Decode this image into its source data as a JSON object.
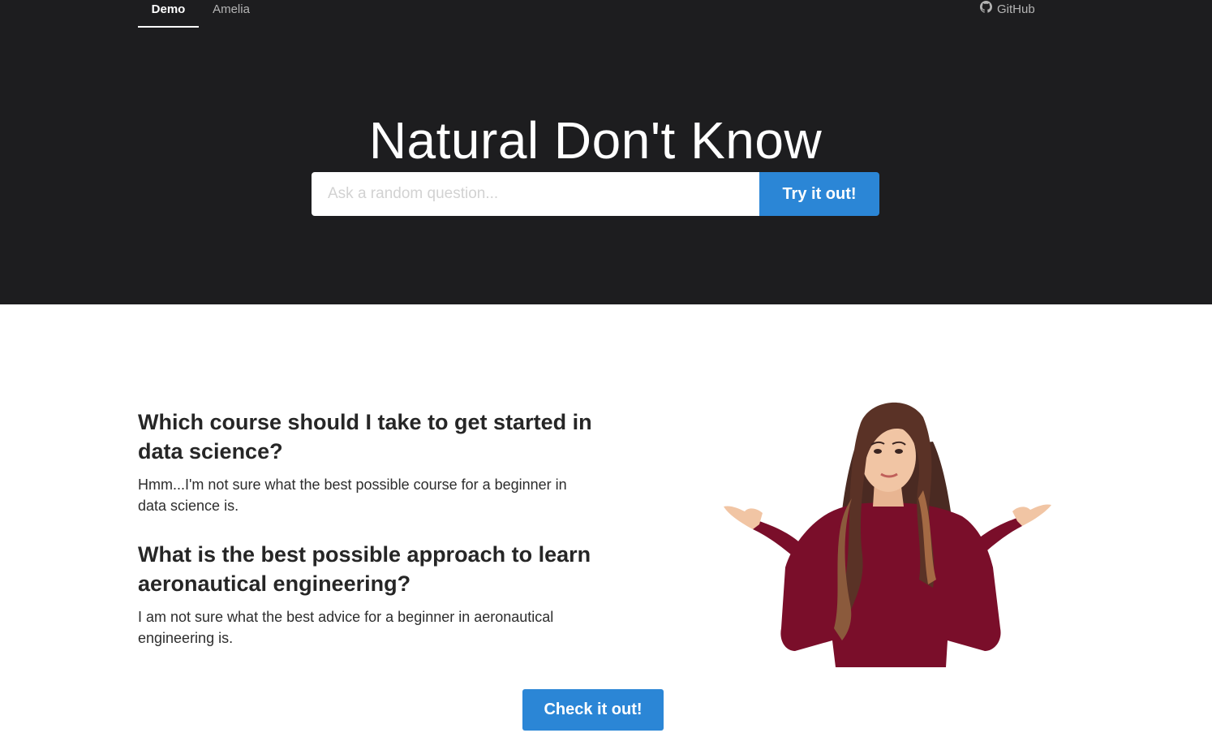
{
  "nav": {
    "tabs": [
      {
        "label": "Demo",
        "active": true
      },
      {
        "label": "Amelia",
        "active": false
      }
    ],
    "github_label": "GitHub",
    "github_icon": "github-icon"
  },
  "hero": {
    "title": "Natural Don't Know",
    "search_placeholder": "Ask a random question...",
    "search_value": "",
    "submit_label": "Try it out!"
  },
  "examples": [
    {
      "question": "Which course should I take to get started in data science?",
      "answer": "Hmm...I'm not sure what the best possible course for a beginner in data science is."
    },
    {
      "question": "What is the best possible approach to learn aeronautical engineering?",
      "answer": "I am not sure what the best advice for a beginner in aeronautical engineering is."
    }
  ],
  "cta_label": "Check it out!",
  "colors": {
    "hero_bg": "#1d1d1f",
    "accent": "#2b86d6",
    "sweater": "#7a0e2a",
    "hair": "#4a2a22",
    "skin": "#f1c5a4"
  }
}
